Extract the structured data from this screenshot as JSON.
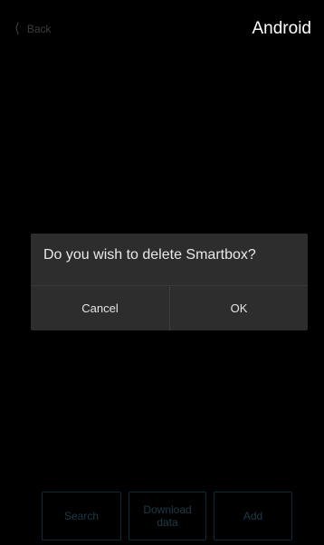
{
  "header": {
    "back_icon": "chevron-left-icon",
    "back_label": "Back",
    "platform_label": "Android"
  },
  "dialog": {
    "message": "Do you wish to delete Smartbox?",
    "cancel_label": "Cancel",
    "ok_label": "OK"
  },
  "toolbar": {
    "search_label": "Search",
    "download_label": "Download data",
    "add_label": "Add"
  },
  "colors": {
    "background": "#000000",
    "dialog_bg": "#2d2d2d",
    "dialog_text": "#e9e9e9",
    "dimmed_button_border": "#0b2a36",
    "dimmed_button_text": "#1e3b47"
  }
}
